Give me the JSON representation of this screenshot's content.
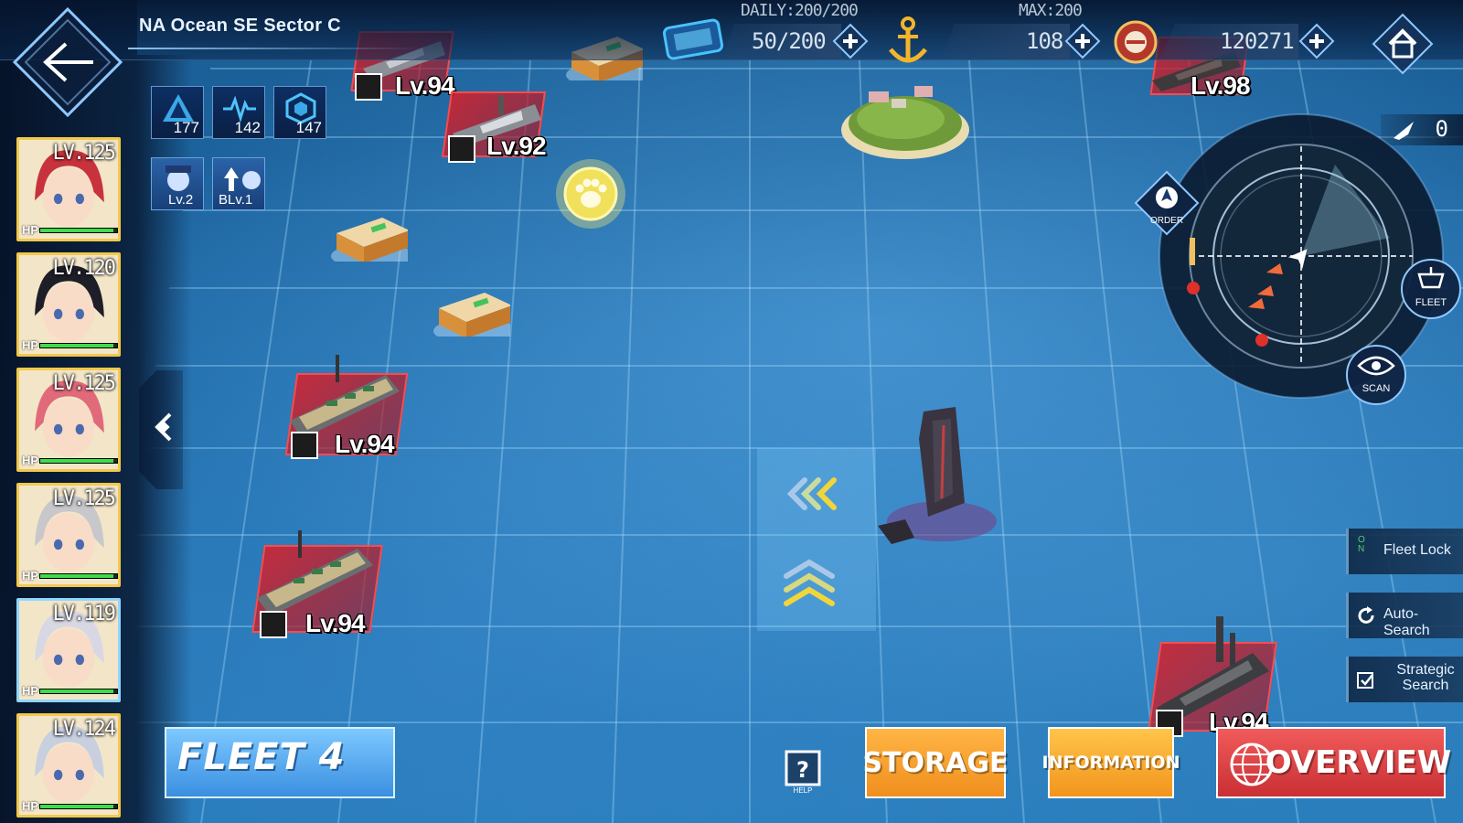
{
  "header": {
    "sector_title": "NA Ocean SE Sector C",
    "daily_caption": "DAILY:200/200",
    "oil_value": "50/200",
    "max_caption": "MAX:200",
    "ship_count": "108",
    "coins": "120271"
  },
  "buffs": [
    {
      "value": "177",
      "icon": "air-icon"
    },
    {
      "value": "142",
      "icon": "heartbeat-icon"
    },
    {
      "value": "147",
      "icon": "hexagon-icon"
    }
  ],
  "badges": [
    {
      "label": "Lv.2",
      "icon": "captain-icon"
    },
    {
      "label": "BLv.1",
      "icon": "upgrade-icon"
    }
  ],
  "fleet_members": [
    {
      "level": "LV.125",
      "hp_label": "HP",
      "hp": 0.95,
      "hair": "#c8323c"
    },
    {
      "level": "LV.120",
      "hp_label": "HP",
      "hp": 0.95,
      "hair": "#1e1e28"
    },
    {
      "level": "LV.125",
      "hp_label": "HP",
      "hp": 0.95,
      "hair": "#e06a7a"
    },
    {
      "level": "LV.125",
      "hp_label": "HP",
      "hp": 0.95,
      "hair": "#c8c8cc"
    },
    {
      "level": "LV.119",
      "hp_label": "HP",
      "hp": 0.95,
      "hair": "#d8d8e4"
    },
    {
      "level": "LV.124",
      "hp_label": "HP",
      "hp": 0.95,
      "hair": "#c8d0e0"
    }
  ],
  "enemies": [
    {
      "level": "Lv.94"
    },
    {
      "level": "Lv.92"
    },
    {
      "level": "Lv.98"
    },
    {
      "level": "Lv.94"
    },
    {
      "level": "Lv.94"
    },
    {
      "level": "Lv.94"
    }
  ],
  "radar": {
    "order_label": "ORDER",
    "fleet_label": "FLEET",
    "scan_label": "SCAN",
    "counter": "0"
  },
  "side_buttons": {
    "fleet_lock_toggle": "ON",
    "fleet_lock": "Fleet Lock",
    "auto_search": "Auto-Search",
    "strategic_search": "Strategic Search"
  },
  "bottom": {
    "fleet": "FLEET 4",
    "help": "HELP",
    "storage": "STORAGE",
    "information": "INFORMATION",
    "overview": "OVERVIEW"
  },
  "colors": {
    "accent_blue": "#3a8fe0",
    "storage_orange": "#f08f1e",
    "overview_red": "#c92f33",
    "enemy_red": "#dc1e28",
    "rare_gold": "#f2c94c"
  }
}
